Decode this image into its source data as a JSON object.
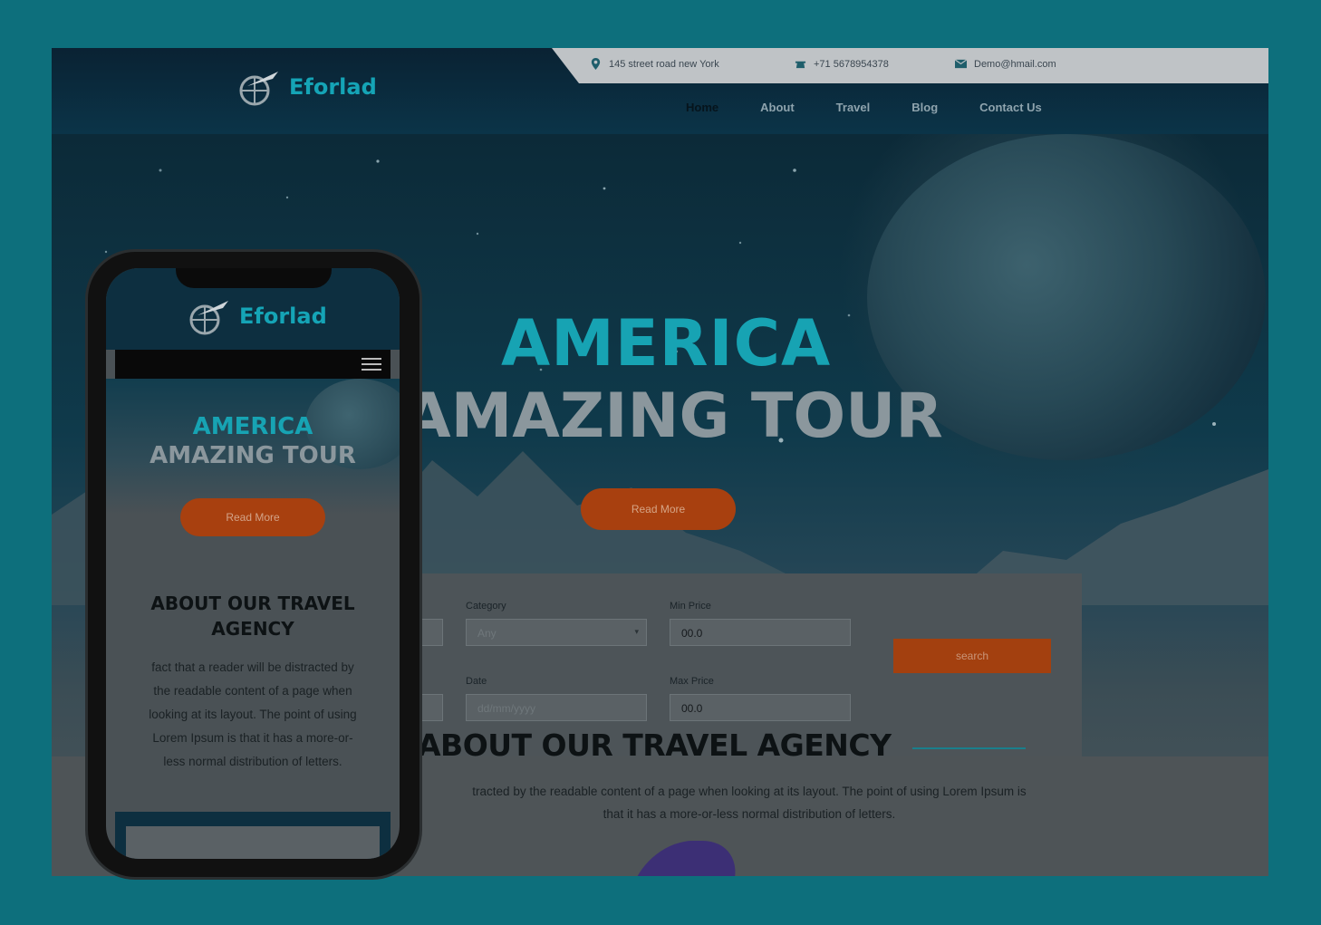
{
  "topbar": {
    "address": "145 street road new York",
    "phone": "+71 5678954378",
    "email": "Demo@hmail.com"
  },
  "brand": {
    "name": "Eforlad"
  },
  "nav": {
    "items": [
      {
        "label": "Home",
        "active": true
      },
      {
        "label": "About"
      },
      {
        "label": "Travel"
      },
      {
        "label": "Blog"
      },
      {
        "label": "Contact Us"
      }
    ]
  },
  "hero": {
    "title_line1": "AMERICA",
    "title_line2": "AMAZING TOUR",
    "read_more": "Read More"
  },
  "search": {
    "category_label": "Category",
    "category_value": "Any",
    "min_price_label": "Min Price",
    "min_price_value": "00.0",
    "date_label": "Date",
    "date_placeholder": "dd/mm/yyyy",
    "max_price_label": "Max Price",
    "max_price_value": "00.0",
    "button": "search"
  },
  "about": {
    "title": "ABOUT OUR TRAVEL AGENCY",
    "text_line1": "tracted by the readable content of a page when looking at its layout. The point of using Lorem Ipsum is",
    "text_line2": "that it has a more-or-less normal distribution of letters."
  },
  "mobile": {
    "brand": "Eforlad",
    "title_line1": "AMERICA",
    "title_line2": "AMAZING TOUR",
    "read_more": "Read More",
    "about_title_line1": "ABOUT OUR TRAVEL",
    "about_title_line2": "AGENCY",
    "about_lines": [
      "fact that a reader will be distracted by",
      "the readable content of a page when",
      "looking at its layout. The point of using",
      "Lorem Ipsum is that it has a more-or-",
      "less normal distribution of letters."
    ]
  },
  "colors": {
    "background": "#0d6f7c",
    "accent_teal": "#17a3b3",
    "accent_orange": "#a8400f"
  },
  "icons": [
    "location-icon",
    "phone-icon",
    "mail-icon",
    "logo-globe-plane-icon",
    "hamburger-menu-icon",
    "dropdown-caret-icon"
  ]
}
